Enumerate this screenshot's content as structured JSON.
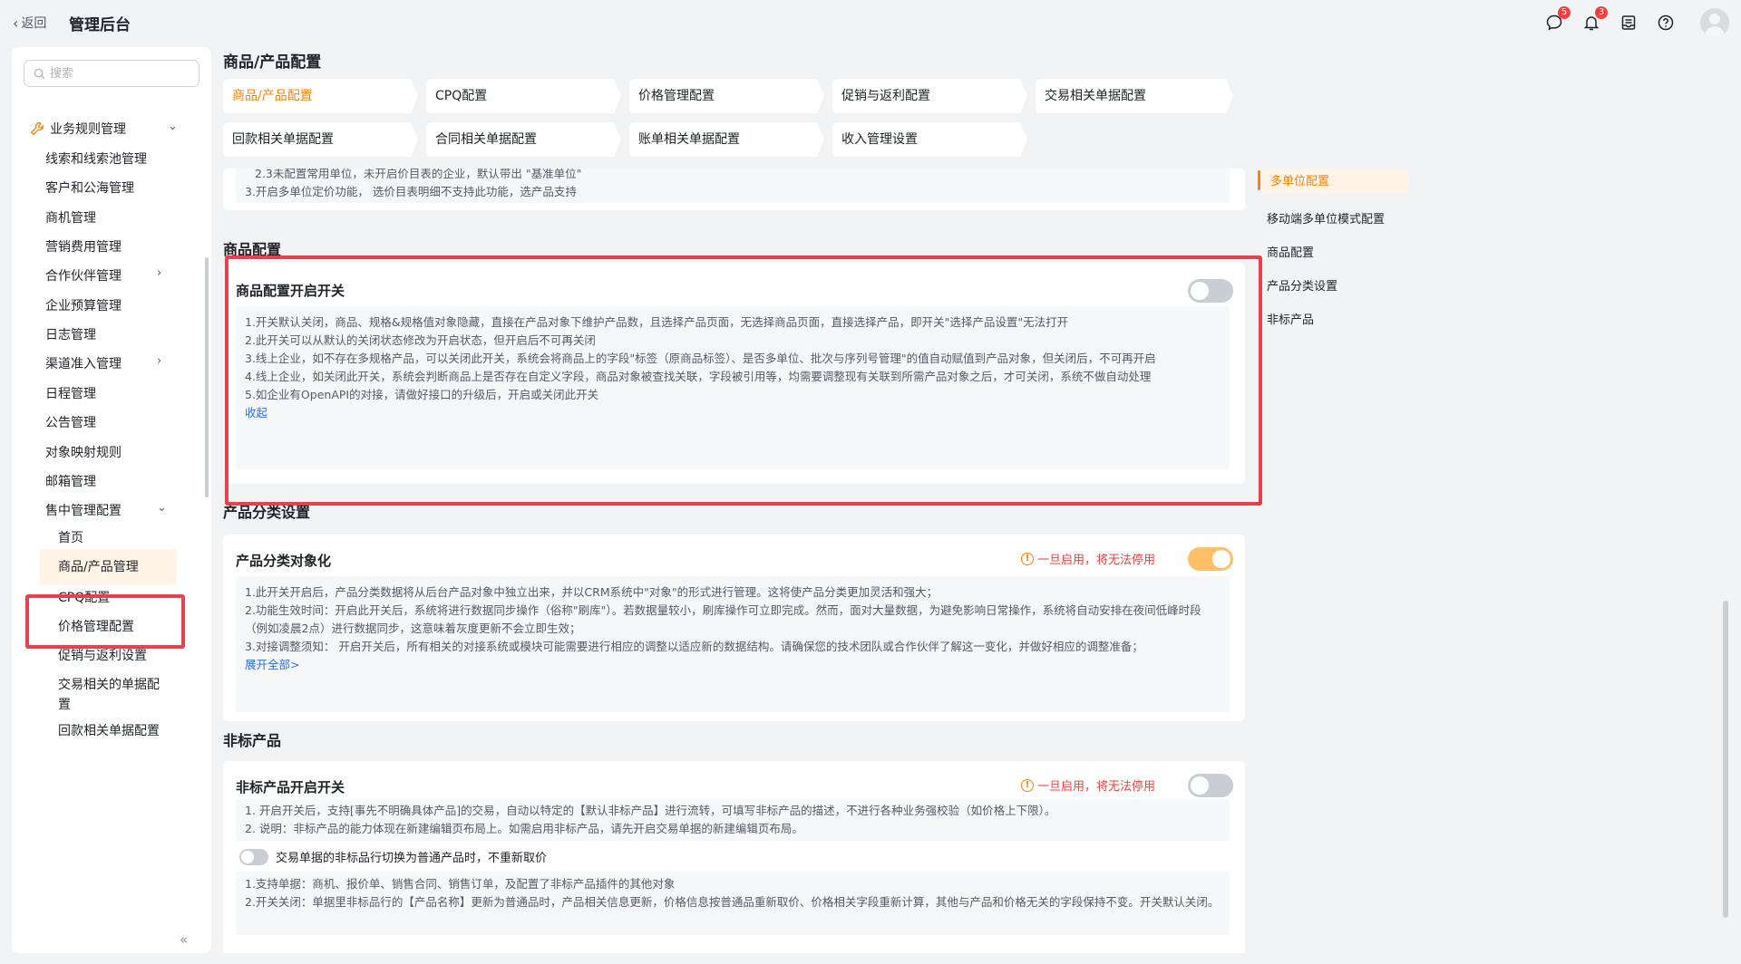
{
  "topbar": {
    "back_label": "返回",
    "app_title": "管理后台",
    "icons": [
      {
        "name": "message-icon",
        "badge": "5"
      },
      {
        "name": "bell-icon",
        "badge": "3"
      },
      {
        "name": "inbox-icon",
        "badge": ""
      },
      {
        "name": "help-icon",
        "badge": ""
      }
    ]
  },
  "sidebar": {
    "search_placeholder": "搜索",
    "group_label": "业务规则管理",
    "items": [
      {
        "label": "线索和线索池管理"
      },
      {
        "label": "客户和公海管理"
      },
      {
        "label": "商机管理"
      },
      {
        "label": "营销费用管理"
      },
      {
        "label": "合作伙伴管理"
      },
      {
        "label": "企业预算管理"
      },
      {
        "label": "日志管理"
      },
      {
        "label": "渠道准入管理"
      },
      {
        "label": "日程管理"
      },
      {
        "label": "公告管理"
      },
      {
        "label": "对象映射规则"
      },
      {
        "label": "邮箱管理"
      },
      {
        "label": "售中管理配置"
      }
    ],
    "sub_items": [
      {
        "label": "首页"
      },
      {
        "label": "商品/产品管理"
      },
      {
        "label": "CPQ配置"
      },
      {
        "label": "价格管理配置"
      },
      {
        "label": "促销与返利设置"
      },
      {
        "label": "交易相关的单据配置"
      },
      {
        "label": "回款相关单据配置"
      }
    ],
    "collapse_label": "«"
  },
  "page": {
    "title": "商品/产品配置",
    "tabs": [
      {
        "label": "商品/产品配置"
      },
      {
        "label": "CPQ配置"
      },
      {
        "label": "价格管理配置"
      },
      {
        "label": "促销与返利配置"
      },
      {
        "label": "交易相关单据配置"
      },
      {
        "label": "回款相关单据配置"
      },
      {
        "label": "合同相关单据配置"
      },
      {
        "label": "账单相关单据配置"
      },
      {
        "label": "收入管理设置"
      }
    ]
  },
  "content": {
    "top_desc": [
      "2.3未配置常用单位，未开启价目表的企业，默认带出 \"基准单位\"",
      "3.开启多单位定价功能， 选价目表明细不支持此功能，选产品支持"
    ],
    "product_config": {
      "section_title": "商品配置",
      "card_title": "商品配置开启开关",
      "switch_on": false,
      "lines": [
        "1.开关默认关闭，商品、规格&规格值对象隐藏，直接在产品对象下维护产品数，且选择产品页面，无选择商品页面，直接选择产品，即开关\"选择产品设置\"无法打开",
        "2.此开关可以从默认的关闭状态修改为开启状态，但开启后不可再关闭",
        "3.线上企业，如不存在多规格产品，可以关闭此开关，系统会将商品上的字段\"标签（原商品标签）、是否多单位、批次与序列号管理\"的值自动赋值到产品对象，但关闭后，不可再开启",
        "4.线上企业，如关闭此开关，系统会判断商品上是否存在自定义字段，商品对象被查找关联，字段被引用等，均需要调整现有关联到所需产品对象之后，才可关闭，系统不做自动处理",
        "5.如企业有OpenAPI的对接，请做好接口的升级后，开启或关闭此开关"
      ],
      "collapse_link": "收起"
    },
    "category": {
      "section_title": "产品分类设置",
      "card_title": "产品分类对象化",
      "warning": "一旦启用，将无法停用",
      "switch_on": true,
      "lines": [
        "1.此开关开启后，产品分类数据将从后台产品对象中独立出来，并以CRM系统中\"对象\"的形式进行管理。这将使产品分类更加灵活和强大；",
        "2.功能生效时间：开启此开关后，系统将进行数据同步操作（俗称\"刷库\"）。若数据量较小，刷库操作可立即完成。然而，面对大量数据，为避免影响日常操作，系统将自动安排在夜间低峰时段（例如凌晨2点）进行数据同步，这意味着灰度更新不会立即生效；",
        "3.对接调整须知： 开启开关后，所有相关的对接系统或模块可能需要进行相应的调整以适应新的数据结构。请确保您的技术团队或合作伙伴了解这一变化，并做好相应的调整准备；"
      ],
      "expand_link": "展开全部>"
    },
    "nonstandard": {
      "section_title": "非标产品",
      "card_title": "非标产品开启开关",
      "warning": "一旦启用，将无法停用",
      "switch_on": false,
      "lines": [
        "1. 开启开关后，支持[事先不明确具体产品]的交易，自动以特定的【默认非标产品】进行流转，可填写非标产品的描述，不进行各种业务强校验（如价格上下限）。",
        "2. 说明：非标产品的能力体现在新建编辑页布局上。如需启用非标产品，请先开启交易单据的新建编辑页布局。"
      ],
      "option_label": "交易单据的非标品行切换为普通产品时，不重新取价",
      "option_lines": [
        "1.支持单据：商机、报价单、销售合同、销售订单，及配置了非标产品插件的其他对象",
        "2.开关关闭：单据里非标品行的【产品名称】更新为普通品时，产品相关信息更新，价格信息按普通品重新取价、价格相关字段重新计算，其他与产品和价格无关的字段保持不变。开关默认关闭。"
      ]
    }
  },
  "anchor_nav": {
    "items": [
      {
        "label": "多单位配置"
      },
      {
        "label": "移动端多单位模式配置"
      },
      {
        "label": "商品配置"
      },
      {
        "label": "产品分类设置"
      },
      {
        "label": "非标产品"
      }
    ]
  },
  "colors": {
    "accent": "#ff8000",
    "danger": "#e8404d",
    "link": "#2d6ff2"
  }
}
